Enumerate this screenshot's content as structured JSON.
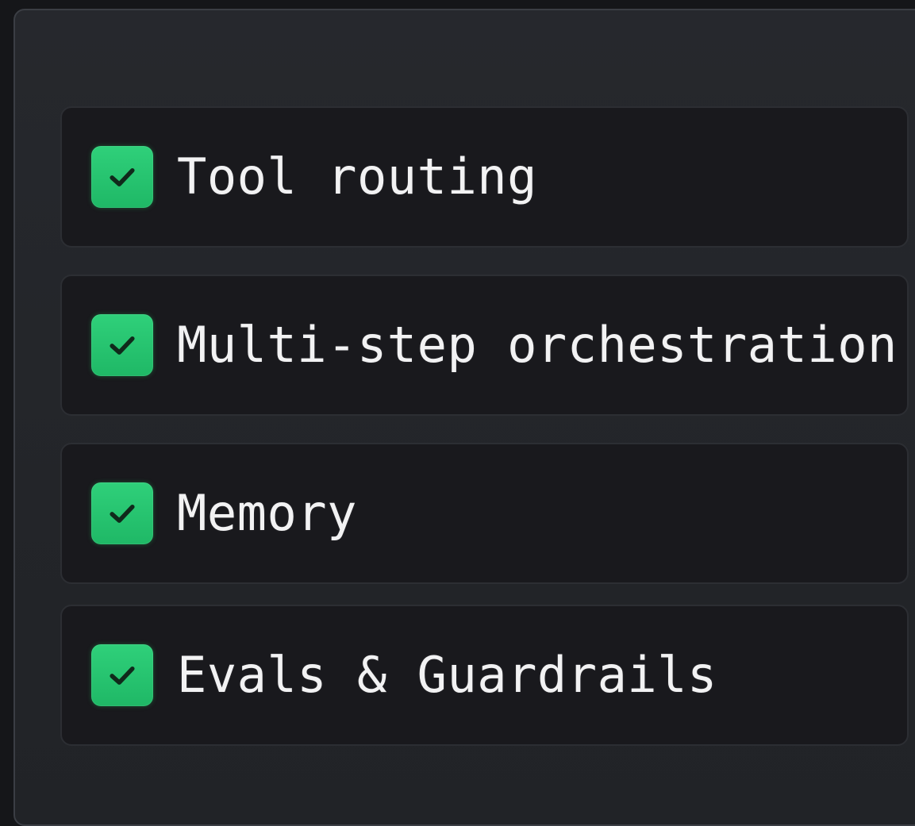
{
  "checklist": {
    "items": [
      {
        "label": "Tool routing",
        "checked": true
      },
      {
        "label": "Multi-step orchestration",
        "checked": true
      },
      {
        "label": "Memory",
        "checked": true
      },
      {
        "label": "Evals & Guardrails",
        "checked": true
      }
    ]
  },
  "colors": {
    "background": "#151619",
    "panel": "#25272b",
    "item_background": "#19191d",
    "checkbox_green": "#22c56e",
    "check_mark": "#10291b",
    "text": "#f2f2f3"
  },
  "icons": {
    "checkbox": "check-icon"
  }
}
